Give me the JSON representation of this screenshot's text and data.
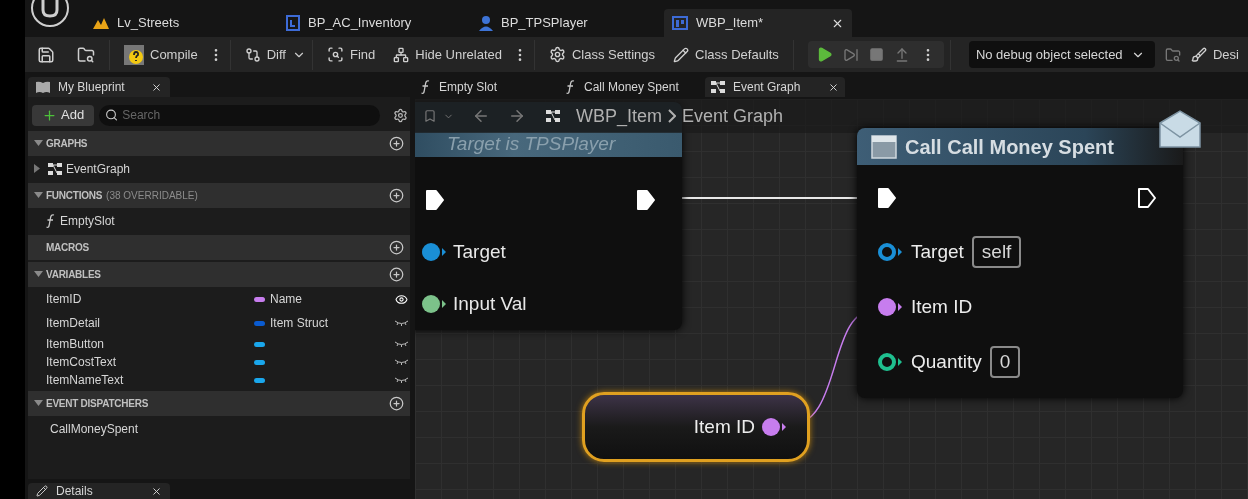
{
  "editor_tabs": [
    {
      "label": "Lv_Streets",
      "kind": "level",
      "selected": false
    },
    {
      "label": "BP_AC_Inventory",
      "kind": "component",
      "selected": false
    },
    {
      "label": "BP_TPSPlayer",
      "kind": "character",
      "selected": false
    },
    {
      "label": "WBP_Item*",
      "kind": "widget",
      "selected": true
    }
  ],
  "toolbar": {
    "compile": "Compile",
    "diff": "Diff",
    "find": "Find",
    "hide_unrelated": "Hide Unrelated",
    "class_settings": "Class Settings",
    "class_defaults": "Class Defaults",
    "debug_object": "No debug object selected",
    "designer": "Desi"
  },
  "my_blueprint": {
    "title": "My Blueprint",
    "add": "Add",
    "search_placeholder": "Search",
    "sections": [
      {
        "title": "GRAPHS",
        "expanded": true,
        "items": [
          {
            "label": "EventGraph",
            "kind": "graph"
          }
        ]
      },
      {
        "title": "FUNCTIONS",
        "note": "(38 OVERRIDABLE)",
        "expanded": true,
        "items": [
          {
            "label": "EmptySlot",
            "kind": "function"
          }
        ]
      },
      {
        "title": "MACROS"
      },
      {
        "title": "VARIABLES",
        "expanded": true,
        "variables": [
          {
            "name": "ItemID",
            "type": "Name",
            "color": "#c77dee",
            "visible": true
          },
          {
            "name": "ItemDetail",
            "type": "Item Struct",
            "color": "#0a5bd0",
            "visible": false
          },
          {
            "name": "ItemButton",
            "color": "#1aa7ec",
            "visible": false
          },
          {
            "name": "ItemCostText",
            "color": "#1aa7ec",
            "visible": false
          },
          {
            "name": "ItemNameText",
            "color": "#1aa7ec",
            "visible": false
          }
        ]
      },
      {
        "title": "EVENT DISPATCHERS",
        "expanded": true,
        "items": [
          {
            "label": "CallMoneySpent",
            "kind": "dispatcher"
          }
        ]
      }
    ]
  },
  "details_tab": "Details",
  "graph_tabs": [
    {
      "label": "Empty Slot",
      "kind": "function",
      "selected": false
    },
    {
      "label": "Call Money Spent",
      "kind": "function",
      "selected": false
    },
    {
      "label": "Event Graph",
      "kind": "graph",
      "selected": true
    }
  ],
  "breadcrumb": [
    "WBP_Item",
    "Event Graph"
  ],
  "update_node": {
    "subtitle": "Target is TPSPlayer",
    "exec_in_connected": true,
    "exec_out_connected": true,
    "pins": [
      {
        "label": "Target",
        "color": "#1a8fd6",
        "connected": true
      },
      {
        "label": "Input Val",
        "color": "#7cc28a",
        "connected": true
      }
    ]
  },
  "call_node": {
    "title": "Call Call Money Spent",
    "exec_in_connected": true,
    "exec_out_connected": false,
    "pins": [
      {
        "label": "Target",
        "color": "#1a8fd6",
        "connected": false,
        "value": "self"
      },
      {
        "label": "Item ID",
        "color": "#c77dee",
        "connected": true
      },
      {
        "label": "Quantity",
        "color": "#1fbf8f",
        "connected": false,
        "value": "0"
      }
    ]
  },
  "getter_node": {
    "label": "Item ID",
    "color": "#c77dee"
  }
}
